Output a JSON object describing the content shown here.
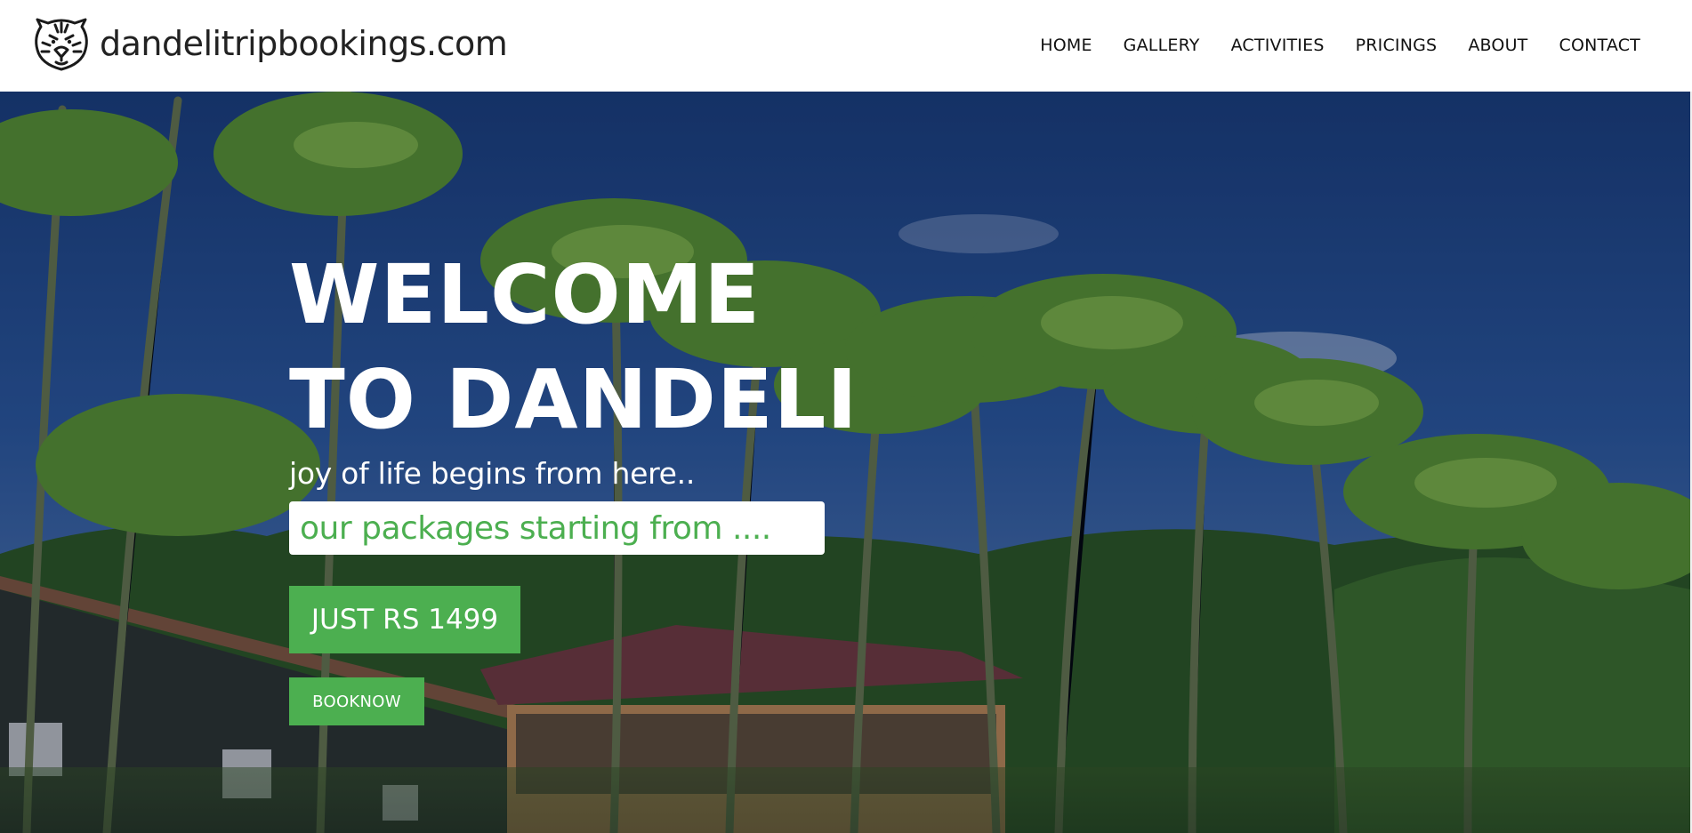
{
  "header": {
    "site_name": "dandelitripbookings.com",
    "logo_icon": "tiger-face-icon",
    "nav": [
      {
        "label": "HOME"
      },
      {
        "label": "GALLERY"
      },
      {
        "label": "ACTIVITIES"
      },
      {
        "label": "PRICINGS"
      },
      {
        "label": "ABOUT"
      },
      {
        "label": "CONTACT"
      }
    ]
  },
  "hero": {
    "title_line1": "WELCOME",
    "title_line2": "TO DANDELI",
    "tagline": "joy of life begins from here..",
    "packages_text": "our packages starting from ....",
    "price_label": "JUST RS 1499",
    "book_label": "BOOKNOW",
    "background": "palm-trees-resort-photo"
  },
  "colors": {
    "accent_green": "#4caf50",
    "header_bg": "#ffffff",
    "text_dark": "#222222",
    "hero_text": "#ffffff"
  }
}
